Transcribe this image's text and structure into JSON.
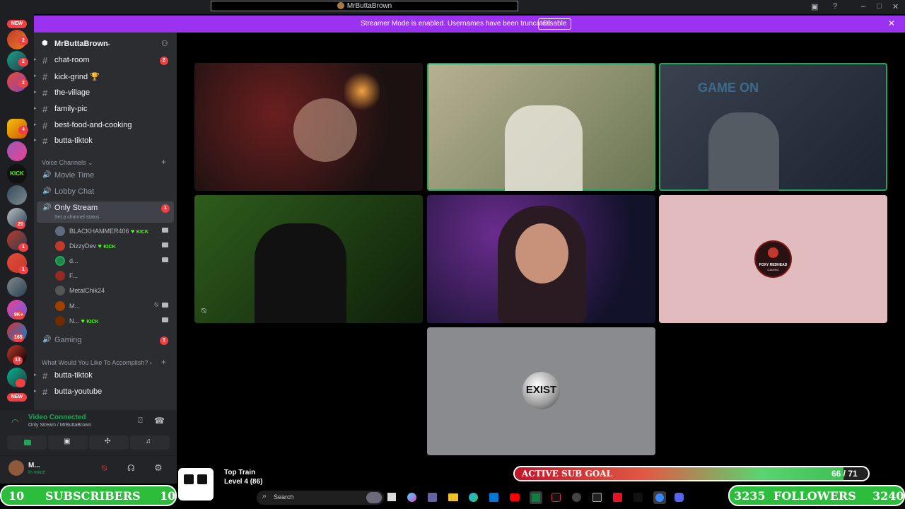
{
  "window": {
    "title": "MrButtaBrown"
  },
  "banner": {
    "message": "Streamer Mode is enabled. Usernames have been truncated.",
    "disable_label": "Disable"
  },
  "rail": {
    "new_label": "NEW",
    "badges": [
      "8",
      "2",
      "2",
      "2",
      "4",
      "1",
      "20",
      "1",
      "1",
      "1K+",
      "9K+",
      "165",
      "13"
    ],
    "new_label_bottom": "NEW",
    "kick_text": "KICK"
  },
  "server": {
    "name": "MrButtaBrown"
  },
  "channels": [
    {
      "name": "chat-room",
      "count": "2"
    },
    {
      "name": "kick-grind 🏆"
    },
    {
      "name": "the-village"
    },
    {
      "name": "family-pic"
    },
    {
      "name": "best-food-and-cooking"
    },
    {
      "name": "butta-tiktok"
    }
  ],
  "voice_category": "Voice Channels",
  "voice_channels": [
    {
      "name": "Movie Time"
    },
    {
      "name": "Lobby Chat"
    },
    {
      "name": "Only Stream",
      "count": "1",
      "status": "Set a channel status"
    }
  ],
  "voice_users": [
    {
      "name": "BLACKHAMMER406",
      "kick": "KICK"
    },
    {
      "name": "DizzyDev",
      "kick": "KICK"
    },
    {
      "name": "d..."
    },
    {
      "name": "F..."
    },
    {
      "name": "MetalChik24"
    },
    {
      "name": "M..."
    },
    {
      "name": "N...",
      "kick": "KICK"
    }
  ],
  "gaming": {
    "name": "Gaming",
    "count": "1"
  },
  "category2": "What Would You Like To Accomplish?",
  "channels2": [
    {
      "name": "butta-tiktok"
    },
    {
      "name": "butta-youtube"
    }
  ],
  "voice_panel": {
    "status": "Video Connected",
    "location": "Only Stream / MrButtaBrown"
  },
  "user_panel": {
    "name": "M...",
    "status": "In voice"
  },
  "tiles": {
    "tile6_logo": "FOXY REDHEAD",
    "tile6_logo_sub": "GAMING",
    "tile7_logo": "EXIST",
    "tile3_sign": "GAME ON"
  },
  "overlay": {
    "subs_left": "10",
    "subs_label": "SUBSCRIBERS",
    "subs_right": "10",
    "train_title": "Top Train",
    "train_level": "Level 4",
    "train_value": "(86)",
    "goal_label": "ACTIVE SUB GOAL",
    "goal_value": "66 / 71",
    "goal_progress": 0.93,
    "follow_left": "3235",
    "follow_label": "FOLLOWERS",
    "follow_right": "3240"
  },
  "taskbar": {
    "search_placeholder": "Search"
  },
  "colors": {
    "accent_purple": "#9b32f0",
    "speaking_green": "#23a559",
    "badge_red": "#f23f43",
    "counter_green": "#2bbd3b"
  }
}
